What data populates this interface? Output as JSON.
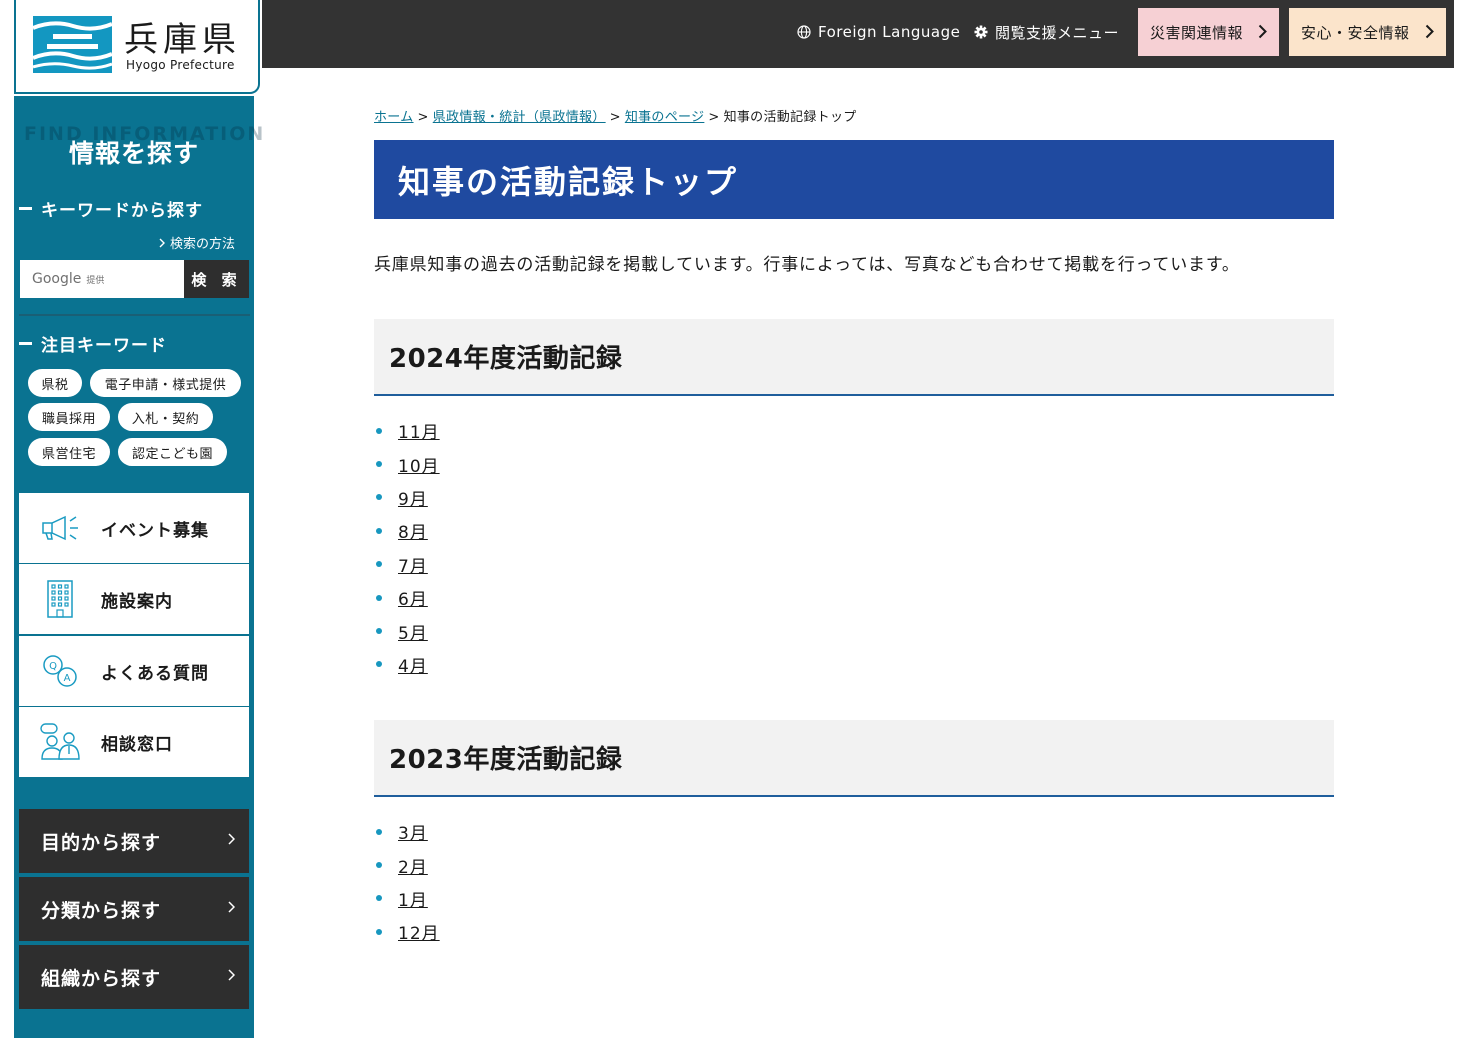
{
  "header": {
    "logo": {
      "title": "兵庫県",
      "subtitle": "Hyogo Prefecture"
    },
    "foreign_language": "Foreign Language",
    "accessibility_menu": "閲覧支援メニュー",
    "disaster_info": "災害関連情報",
    "safety_info": "安心・安全情報"
  },
  "sidebar": {
    "find_en": "FIND INFORMATION",
    "find_ja": "情報を探す",
    "keyword_heading": "キーワードから探す",
    "search_howto": "検索の方法",
    "search_placeholder": "Google",
    "search_provider": "提供",
    "search_button": "検 索",
    "trending_heading": "注目キーワード",
    "keywords": [
      "県税",
      "電子申請・様式提供",
      "職員採用",
      "入札・契約",
      "県営住宅",
      "認定こども園"
    ],
    "menu_items": [
      "イベント募集",
      "施設案内",
      "よくある質問",
      "相談窓口"
    ],
    "browse_items": [
      "目的から探す",
      "分類から探す",
      "組織から探す"
    ]
  },
  "breadcrumb": {
    "items": [
      "ホーム",
      "県政情報・統計（県政情報）",
      "知事のページ"
    ],
    "current": "知事の活動記録トップ"
  },
  "main": {
    "title": "知事の活動記録トップ",
    "intro": "兵庫県知事の過去の活動記録を掲載しています。行事によっては、写真なども合わせて掲載を行っています。",
    "sections": [
      {
        "heading": "2024年度活動記録",
        "months": [
          "11月",
          "10月",
          "9月",
          "8月",
          "7月",
          "6月",
          "5月",
          "4月"
        ]
      },
      {
        "heading": "2023年度活動記録",
        "months": [
          "3月",
          "2月",
          "1月",
          "12月"
        ]
      }
    ]
  },
  "colors": {
    "accent": "#0a7391",
    "title_bar": "#1f4aa0",
    "topbar": "#333333",
    "disaster_bg": "#f6d0d4",
    "safety_bg": "#fbe4cb",
    "bullet": "#1797bf"
  }
}
